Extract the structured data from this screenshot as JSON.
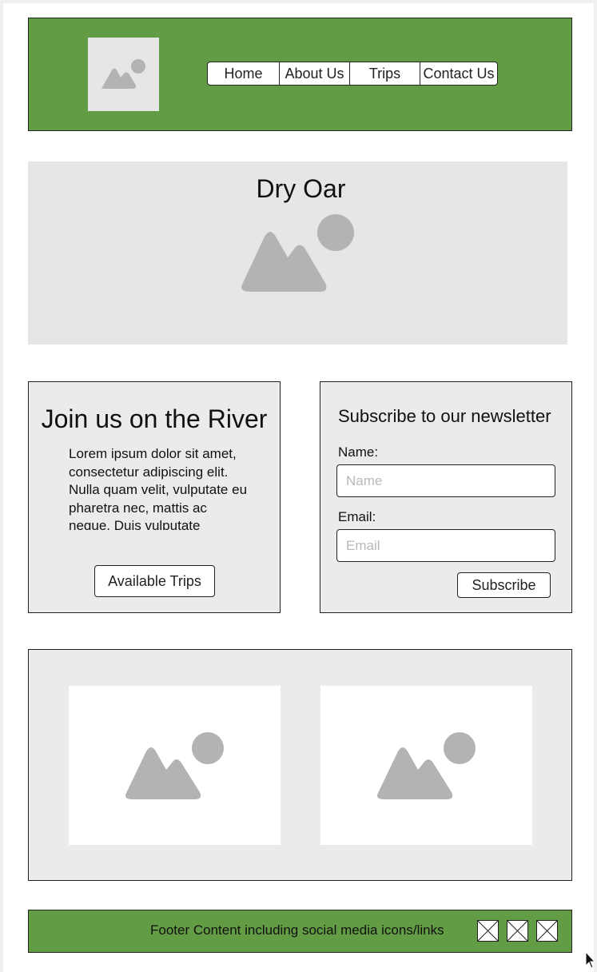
{
  "header": {
    "logo_icon": "image-placeholder-icon",
    "nav": [
      "Home",
      "About Us",
      "Trips",
      "Contact Us"
    ],
    "background": "#629c44"
  },
  "hero": {
    "title": "Dry Oar",
    "image_icon": "image-placeholder-icon"
  },
  "join": {
    "title": "Join us on the River",
    "body": "Lorem ipsum dolor sit amet, consectetur adipiscing elit. Nulla quam velit, vulputate eu pharetra nec, mattis ac neque. Duis vulputate",
    "button_label": "Available Trips"
  },
  "newsletter": {
    "title": "Subscribe to our newsletter",
    "name_label": "Name:",
    "name_placeholder": "Name",
    "email_label": "Email:",
    "email_placeholder": "Email",
    "button_label": "Subscribe"
  },
  "gallery": {
    "images": [
      "image-placeholder-icon",
      "image-placeholder-icon"
    ]
  },
  "footer": {
    "text": "Footer Content including social media icons/links",
    "social_icons": [
      "social-icon-placeholder",
      "social-icon-placeholder",
      "social-icon-placeholder"
    ],
    "background": "#629c44"
  }
}
